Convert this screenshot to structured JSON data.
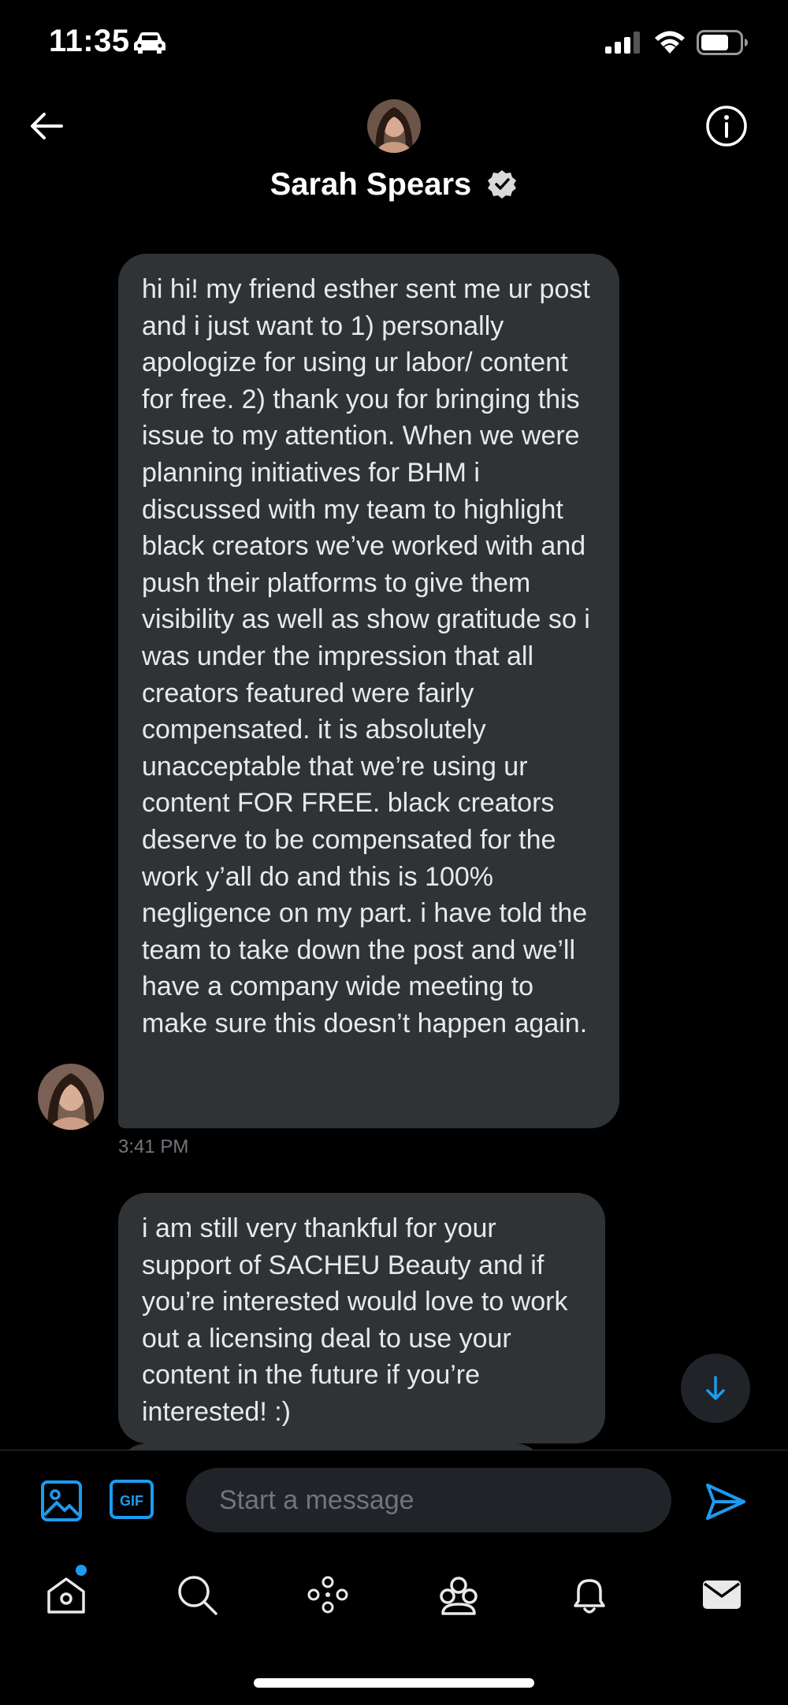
{
  "status_bar": {
    "time": "11:35",
    "icons": [
      "car-icon",
      "signal-icon",
      "wifi-icon",
      "battery-icon"
    ]
  },
  "header": {
    "back_icon": "arrow-left-icon",
    "name": "Sarah Spears",
    "verified_icon": "verified-badge-icon",
    "info_icon": "info-icon"
  },
  "messages": [
    {
      "text": "hi hi! my friend esther sent me ur post and i just want to 1) personally apologize for using ur labor/ content for free. 2) thank you for bringing this issue to my attention. When we were planning initiatives for BHM i discussed with my team to highlight black creators we’ve worked with and push their platforms to give them visibility as well as show gratitude so i was under the impression that all creators featured were fairly compensated. it is absolutely unacceptable that we’re using ur content FOR FREE. black creators deserve to be compensated for the work y’all do and this is 100% negligence on my part. i have told the team to take down the post and we’ll have a company wide meeting to make sure this doesn’t happen again.",
      "timestamp": "3:41 PM"
    },
    {
      "text": "i am still very thankful for your support of SACHEU Beauty and if you’re interested would love to work out a licensing deal to use your content in the future if you’re interested! :)"
    }
  ],
  "composer": {
    "placeholder": "Start a message",
    "icons": [
      "image-icon",
      "gif-icon",
      "send-icon"
    ],
    "gif_label": "GIF"
  },
  "tab_bar": {
    "items": [
      "home-icon",
      "search-icon",
      "spaces-icon",
      "communities-icon",
      "notifications-icon",
      "messages-icon"
    ]
  },
  "colors": {
    "background": "#000000",
    "bubble": "#2f3336",
    "accent": "#1d9bf0",
    "muted_text": "#71767b"
  }
}
